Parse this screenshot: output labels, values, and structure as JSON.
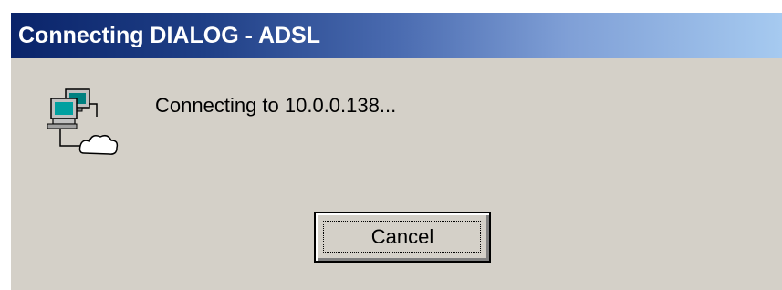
{
  "window": {
    "title": "Connecting DIALOG - ADSL"
  },
  "dialog": {
    "message": "Connecting to 10.0.0.138...",
    "icon": "network-connection-icon"
  },
  "buttons": {
    "cancel_label": "Cancel"
  },
  "colors": {
    "titlebar_start": "#0a246a",
    "titlebar_end": "#a6caf0",
    "face": "#d4d0c8"
  }
}
